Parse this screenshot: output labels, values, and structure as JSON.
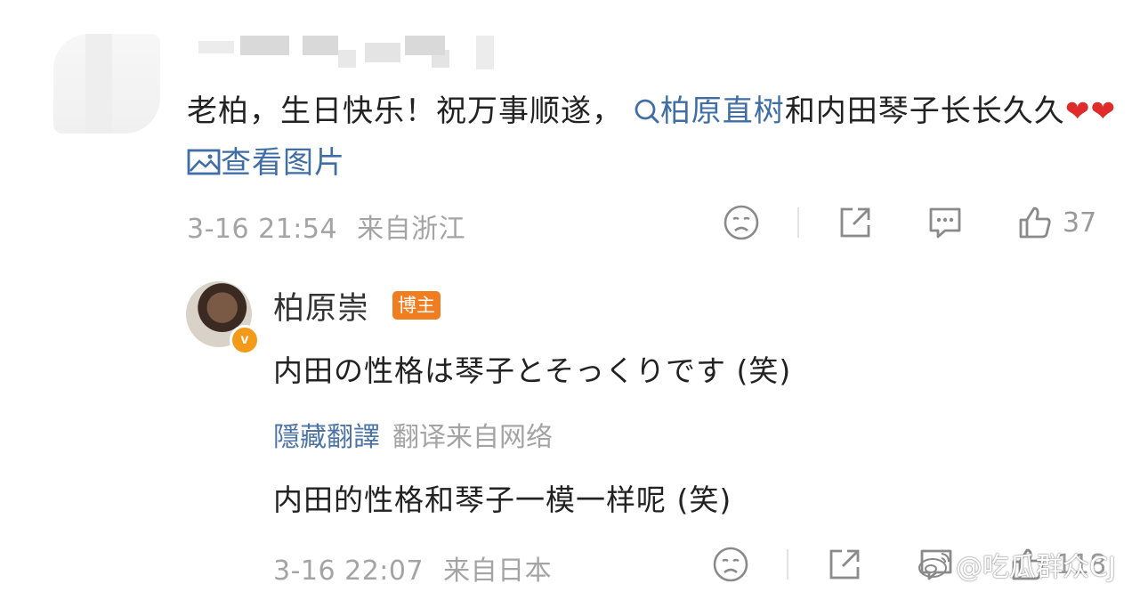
{
  "comment": {
    "text_part1": "老柏，生日快乐！祝万事顺遂，",
    "search_link": "柏原直树",
    "text_part2": "和内田琴子长长久久",
    "heart": "❤",
    "image_link": "查看图片",
    "date": "3-16 21:54",
    "location": "来自浙江",
    "like_count": "37"
  },
  "reply": {
    "name": "柏原崇",
    "badge": "博主",
    "verified": "v",
    "text": "内田の性格は琴子とそっくりです (笑)",
    "hide_translation": "隱藏翻譯",
    "translation_source": "翻译来自网络",
    "translated_text": "内田的性格和琴子一模一样呢 (笑)",
    "date": "3-16 22:07",
    "location": "来自日本",
    "like_count": "118"
  },
  "watermark": "@吃瓜群众CJ",
  "icons": [
    "search-icon",
    "image-icon",
    "sad-face-icon",
    "share-icon",
    "comment-icon",
    "like-icon",
    "weibo-logo-icon"
  ],
  "colors": {
    "link": "#3f6ea6",
    "badge": "#f07e21",
    "verified": "#f39a1b",
    "meta": "#a4a4a4"
  }
}
